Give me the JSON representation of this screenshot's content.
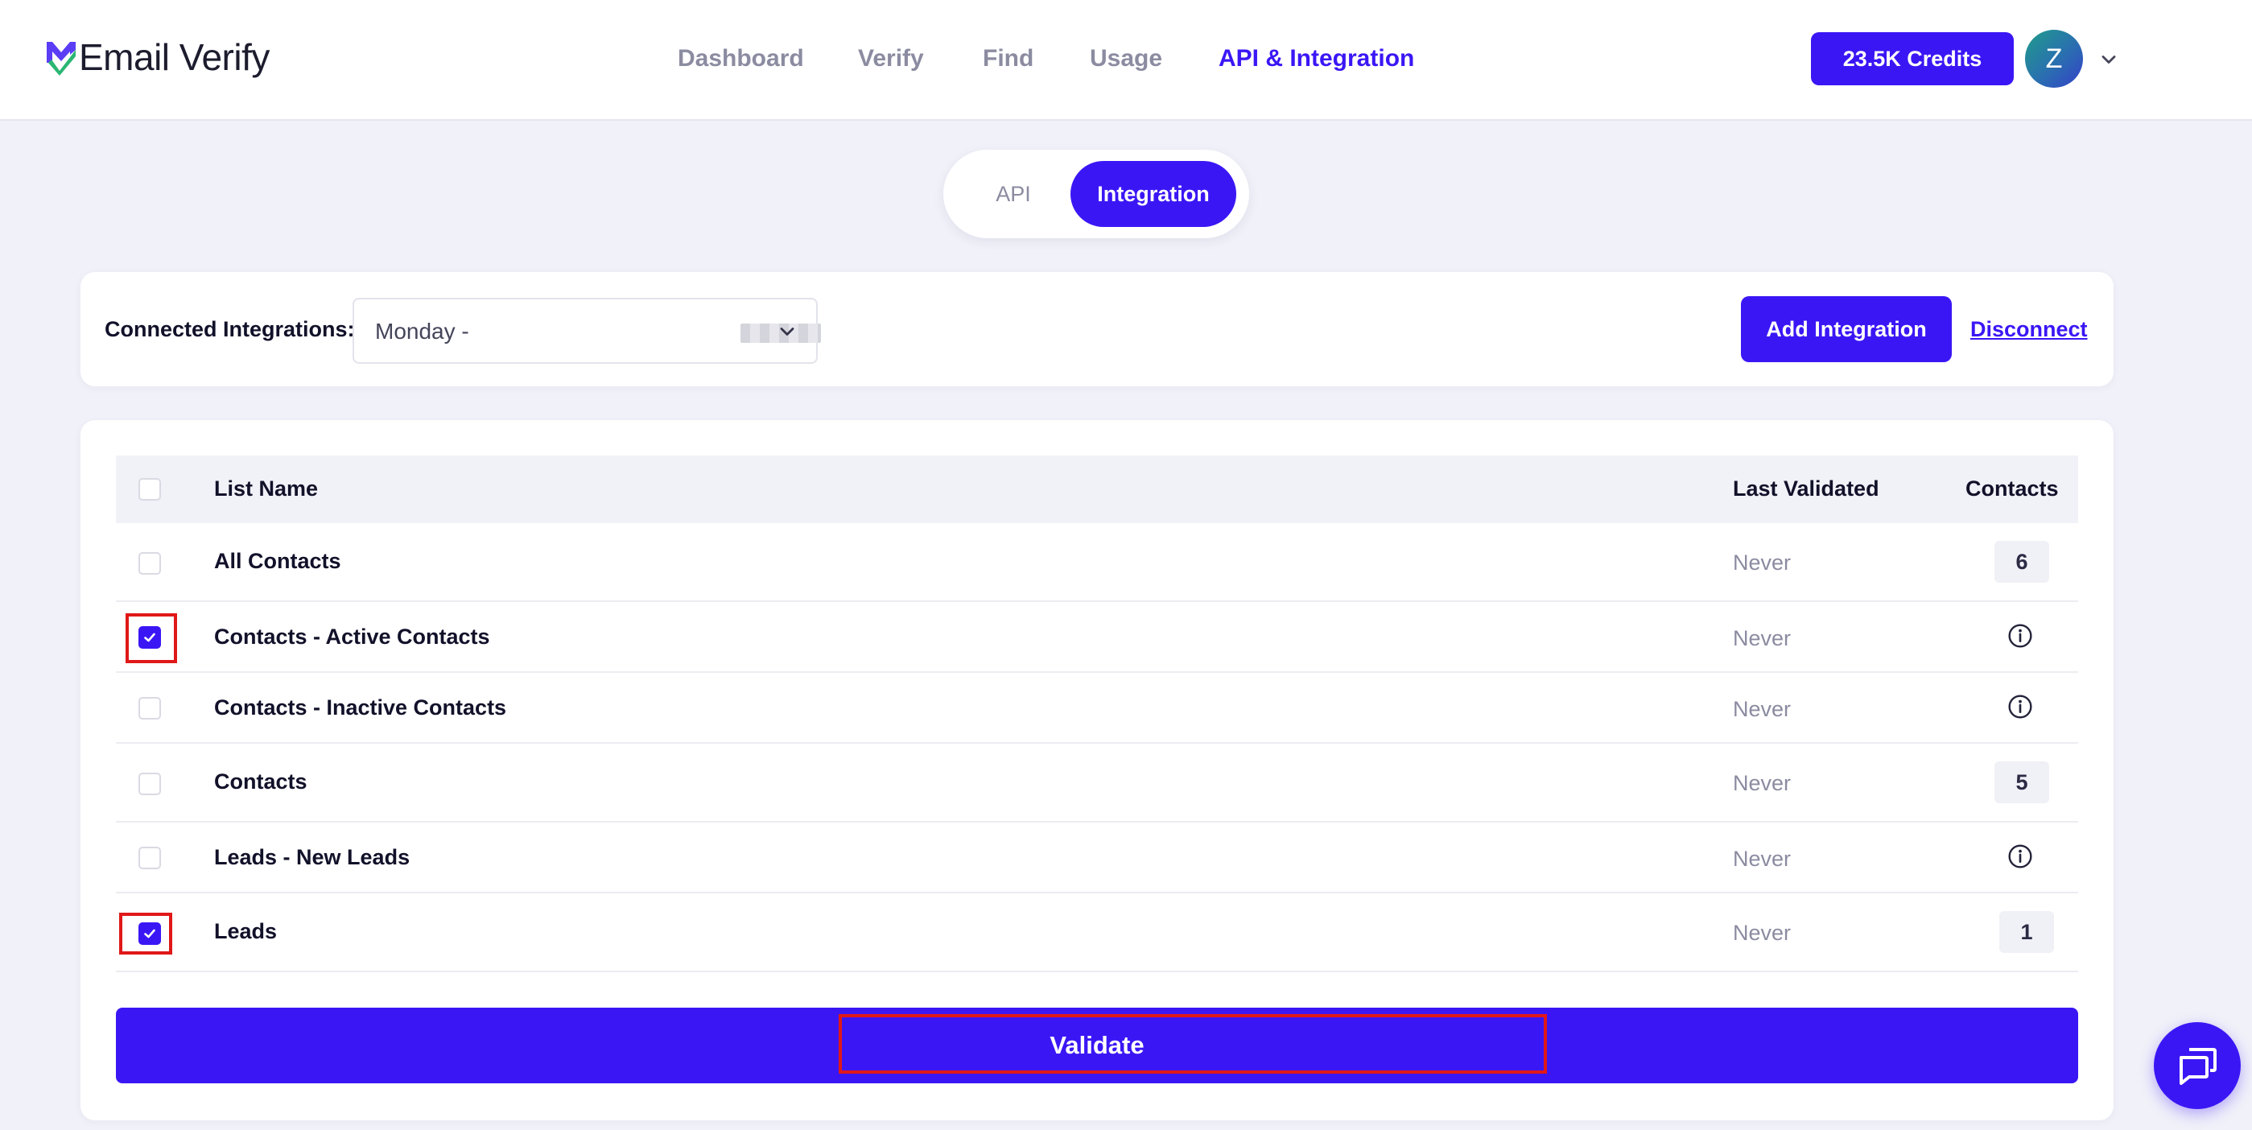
{
  "app": {
    "logo_text": "Email Verify"
  },
  "nav": {
    "items": [
      {
        "label": "Dashboard",
        "active": false
      },
      {
        "label": "Verify",
        "active": false
      },
      {
        "label": "Find",
        "active": false
      },
      {
        "label": "Usage",
        "active": false
      },
      {
        "label": "API & Integration",
        "active": true
      }
    ]
  },
  "header": {
    "credits_label": "23.5K Credits",
    "avatar_initial": "Z"
  },
  "tabs": [
    {
      "label": "API",
      "active": false
    },
    {
      "label": "Integration",
      "active": true
    }
  ],
  "integrations": {
    "label": "Connected Integrations:",
    "selected": "Monday -",
    "add_label": "Add Integration",
    "disconnect_label": "Disconnect"
  },
  "table": {
    "columns": {
      "name": "List Name",
      "last_validated": "Last Validated",
      "contacts": "Contacts"
    },
    "rows": [
      {
        "name": "All Contacts",
        "last_validated": "Never",
        "contacts": "6",
        "checked": false,
        "highlighted": false
      },
      {
        "name": "Contacts - Active Contacts",
        "last_validated": "Never",
        "contacts": "",
        "checked": true,
        "highlighted": true
      },
      {
        "name": "Contacts - Inactive Contacts",
        "last_validated": "Never",
        "contacts": "",
        "checked": false,
        "highlighted": false
      },
      {
        "name": "Contacts",
        "last_validated": "Never",
        "contacts": "5",
        "checked": false,
        "highlighted": false
      },
      {
        "name": "Leads - New Leads",
        "last_validated": "Never",
        "contacts": "",
        "checked": false,
        "highlighted": false
      },
      {
        "name": "Leads",
        "last_validated": "Never",
        "contacts": "1",
        "checked": true,
        "highlighted": true
      }
    ]
  },
  "actions": {
    "validate_label": "Validate"
  },
  "colors": {
    "accent": "#3b16f5",
    "background": "#f1f1f9",
    "highlight": "#e01818",
    "muted_text": "#8b8ba1"
  },
  "icons": {
    "logo": "email-verify-logo-icon",
    "avatar_menu": "chevron-down-icon",
    "select": "chevron-down-icon",
    "row_info": "info-icon",
    "checkbox_check": "check-icon",
    "chat": "chat-bubbles-icon"
  }
}
